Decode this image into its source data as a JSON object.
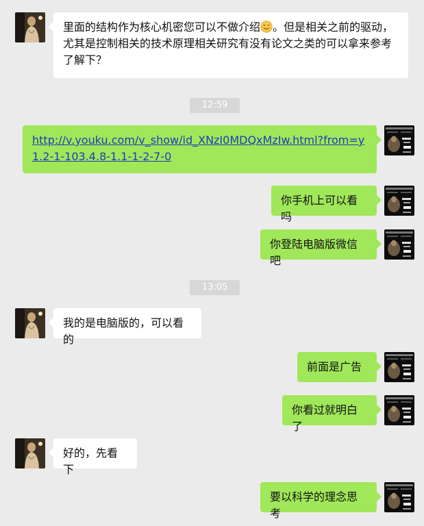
{
  "messages": [
    {
      "side": "in",
      "text_before": "里面的结构作为核心机密您可以不做介绍",
      "emoji": "smiling-face",
      "text_after": "。但是相关之前的驱动，尤其是控制相关的技术原理相关研究有没有论文之类的可以拿来参考了解下？"
    },
    {
      "timestamp": "12:59"
    },
    {
      "side": "out",
      "link": "http://v.youku.com/v_show/id_XNzI0MDQxMzIw.html?from=y1.2-1-103.4.8-1.1-1-2-7-0"
    },
    {
      "side": "out",
      "text": "你手机上可以看吗"
    },
    {
      "side": "out",
      "text": "你登陆电脑版微信吧"
    },
    {
      "timestamp": "13:05"
    },
    {
      "side": "in",
      "text": "我的是电脑版的，可以看的"
    },
    {
      "side": "out",
      "text": "前面是广告"
    },
    {
      "side": "out",
      "text": "你看过就明白了"
    },
    {
      "side": "in",
      "text": "好的，先看下"
    },
    {
      "side": "out",
      "text": "要以科学的理念思考"
    }
  ],
  "colors": {
    "background": "#ebebeb",
    "incoming_bubble": "#ffffff",
    "outgoing_bubble": "#a0e75a",
    "timestamp_bg": "#d7d7d7",
    "link": "#1a3fb8"
  },
  "icons": {
    "contact_avatar": "portrait-avatar-icon",
    "self_avatar": "dark-poster-avatar-icon",
    "emoji": "smiling-face-emoji-icon"
  }
}
